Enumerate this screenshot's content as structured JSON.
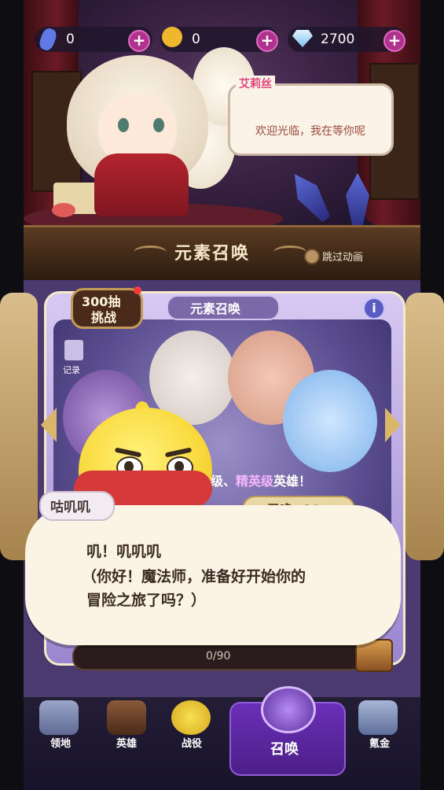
{
  "currency": {
    "item1_value": "0",
    "item2_value": "0",
    "gems_value": "2700"
  },
  "npc": {
    "name": "艾莉丝",
    "greeting": "欢迎光临，我在等你呢"
  },
  "header": {
    "title": "元素召唤",
    "skip_label": "跳过动画"
  },
  "card": {
    "challenge_line1": "300抽",
    "challenge_line2": "挑战",
    "tab_label": "元素召唤",
    "record_label": "记录",
    "info_symbol": "i",
    "hero_text_prefix": "级、",
    "hero_text_highlight": "精英级",
    "hero_text_suffix": "英雄！",
    "summon_button": "召唤×10",
    "progress_text": "0/90"
  },
  "dialog": {
    "speaker": "咕叽叽",
    "line1": "叽！叽叽叽",
    "line2": "（你好！魔法师，准备好开始你的",
    "line3": "冒险之旅了吗？）"
  },
  "nav": {
    "items": [
      {
        "label": "领地",
        "icon": "castle-icon"
      },
      {
        "label": "英雄",
        "icon": "book-icon"
      },
      {
        "label": "战役",
        "icon": "chick-helmet-icon"
      },
      {
        "label": "召唤",
        "icon": "magic-circle-icon"
      },
      {
        "label": "氪金",
        "icon": "treasure-icon"
      }
    ],
    "active": "召唤"
  },
  "colors": {
    "accent_purple": "#6a2fb7",
    "plus_button": "#b0328f",
    "npc_name": "#e0457a"
  }
}
